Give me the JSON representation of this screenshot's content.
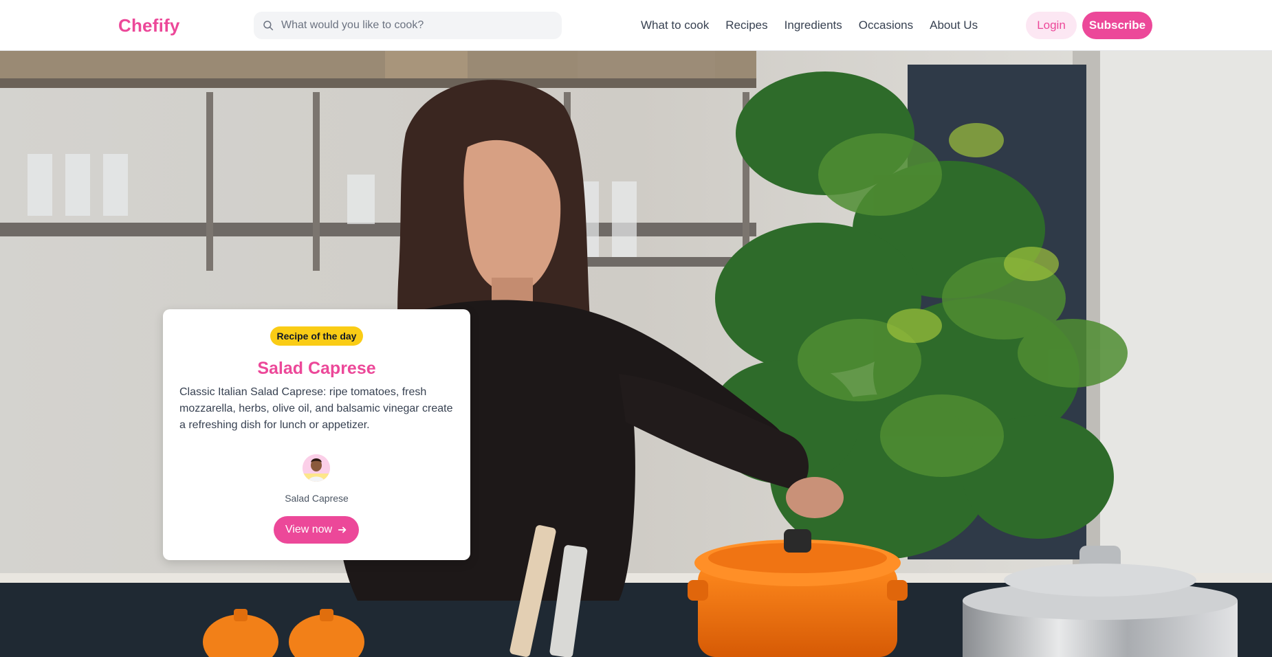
{
  "header": {
    "logo": "Chefify",
    "search_placeholder": "What would you like to cook?",
    "nav": [
      "What to cook",
      "Recipes",
      "Ingredients",
      "Occasions",
      "About Us"
    ],
    "login_label": "Login",
    "subscribe_label": "Subscribe"
  },
  "card": {
    "badge": "Recipe of the day",
    "title": "Salad Caprese",
    "description": "Classic Italian Salad Caprese: ripe tomatoes, fresh mozzarella, herbs, olive oil, and balsamic vinegar create a refreshing dish for lunch or appetizer.",
    "author": "Salad Caprese",
    "button_label": "View now"
  },
  "colors": {
    "brand": "#ec4899",
    "brand_light": "#fce7f3",
    "badge": "#facc15"
  },
  "icons": {
    "search": "search-icon",
    "arrow": "arrow-right-icon",
    "avatar": "avatar"
  }
}
